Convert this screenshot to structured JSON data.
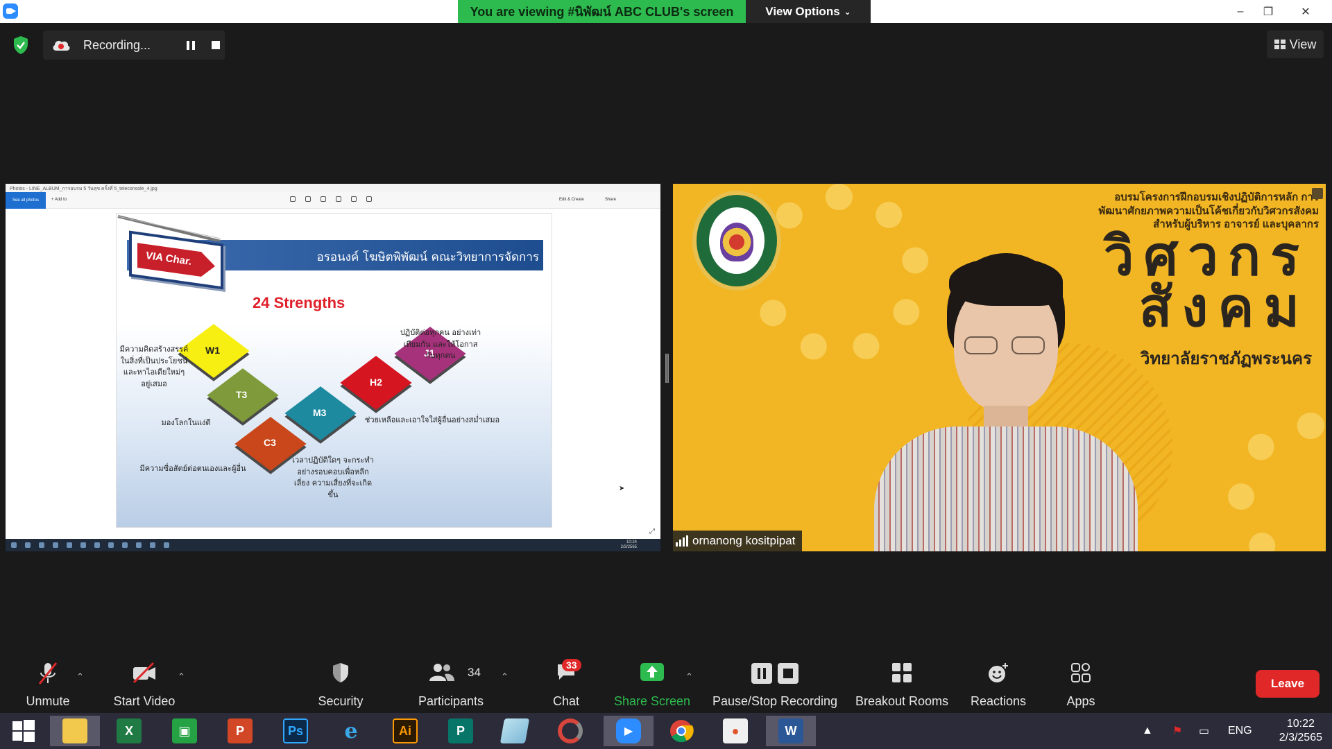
{
  "titlebar": {
    "viewing_banner": "You are viewing #นิพัฒน์ ABC CLUB's screen",
    "view_options": "View Options"
  },
  "recording": {
    "status": "Recording..."
  },
  "view_button": "View",
  "shared_screen": {
    "photos_title": "Photos - LINE_ALBUM_การอบรม 5 วันสุข ครั้งที่ 5_teleconsole_4.jpg",
    "see_all_photos": "See all photos",
    "add_to": "+ Add to",
    "edit_create": "Edit & Create",
    "share": "Share",
    "slide": {
      "header": "อรอนงค์ โฆษิตพิพัฒน์ คณะวิทยาการจัดการ",
      "via": "VIA Char.",
      "title": "24 Strengths",
      "tiles": [
        "W1",
        "T3",
        "C3",
        "M3",
        "H2",
        "J1"
      ],
      "notes": {
        "w1": "มีความคิดสร้างสรรค์ ในสิ่งที่เป็นประโยชน์ และหาไอเดียใหม่ๆ อยู่เสมอ",
        "t3": "มองโลกในแง่ดี",
        "c3": "มีความซื่อสัตย์ต่อตนเองและผู้อื่น",
        "m3": "เวลาปฏิบัติใดๆ จะกระทำ อย่างรอบคอบเพื่อหลีกเลี่ยง ความเสี่ยงที่จะเกิดขึ้น",
        "h2": "ช่วยเหลือและเอาใจใส่ผู้อื่นอย่างสม่ำเสมอ",
        "j1": "ปฏิบัติต่อทุกคน อย่างเท่าเทียมกัน และให้โอกาสกับทุกคน"
      }
    },
    "taskbar_time": "10:24",
    "taskbar_date": "2/3/2565"
  },
  "camera": {
    "header": "อบรมโครงการฝึกอบรมเชิงปฏิบัติการหลัก การพัฒนาศักยภาพความเป็นโค้ชเกี่ยวกับวิศวกรสังคม สำหรับผู้บริหาร อาจารย์ และบุคลากร",
    "big_text": "วิศวกร สังคม",
    "sub_text": "วิทยาลัยราชภัฏพระนคร",
    "participant_name": "ornanong kositpipat"
  },
  "toolbar": {
    "unmute": "Unmute",
    "start_video": "Start Video",
    "security": "Security",
    "participants": "Participants",
    "participants_count": "34",
    "chat": "Chat",
    "chat_badge": "33",
    "share_screen": "Share Screen",
    "pause_stop": "Pause/Stop Recording",
    "breakout": "Breakout Rooms",
    "reactions": "Reactions",
    "apps": "Apps",
    "leave": "Leave"
  },
  "taskbar": {
    "language": "ENG",
    "time": "10:22",
    "date": "2/3/2565"
  },
  "colors": {
    "accent_green": "#2dba4e",
    "leave_red": "#e02828",
    "zoom_blue": "#2d8cff"
  }
}
